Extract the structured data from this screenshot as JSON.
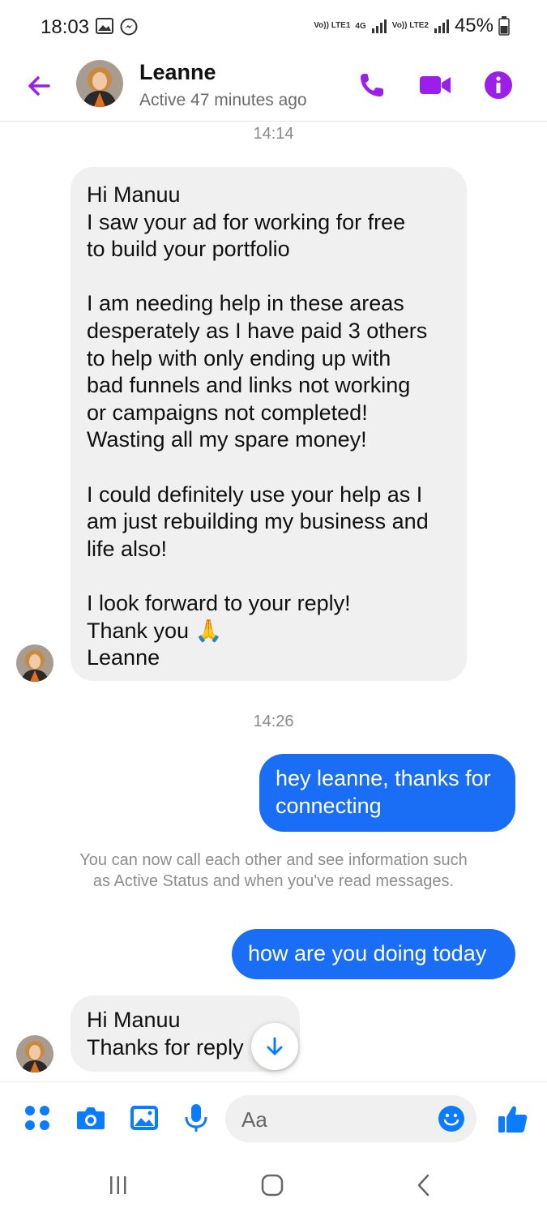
{
  "status_bar": {
    "time": "18:03",
    "network_sim1": "Vo)) LTE1",
    "network_type": "4G",
    "network_sim2": "Vo)) LTE2",
    "battery": "45%",
    "icons": [
      "image-icon",
      "messenger-icon",
      "signal-icon",
      "battery-icon"
    ]
  },
  "header": {
    "contact_name": "Leanne",
    "active_status": "Active 47 minutes ago",
    "accent_color": "#9b1fe8"
  },
  "messages": {
    "timestamp_1": "14:14",
    "incoming_1": "Hi Manuu\nI saw your ad for working for free\nto build your portfolio\n\nI am needing help in these areas\ndesperately as I have paid 3 others\nto help with only ending up with\nbad funnels and links not working\nor campaigns  not completed!\nWasting all my spare money!\n\nI could definitely use your help as I\nam just rebuilding my business and\nlife also!\n\nI look forward to your reply!\nThank you 🙏\nLeanne",
    "timestamp_2": "14:26",
    "outgoing_1": "hey leanne, thanks for\nconnecting",
    "notice": "You can now call each other and see information such as Active Status and when you've read messages.",
    "outgoing_2": "how are you doing today",
    "incoming_2": "Hi Manuu\nThanks for reply",
    "outgoing_color": "#1a6ef5"
  },
  "composer": {
    "placeholder": "Aa",
    "accent_color": "#0a7cff"
  }
}
